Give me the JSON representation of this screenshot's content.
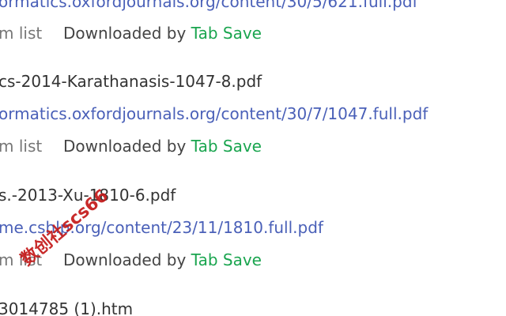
{
  "items": [
    {
      "filename": "",
      "url": "ormatics.oxfordjournals.org/content/30/5/621.full.pdf",
      "remove_label": "m list",
      "downloaded_prefix": "Downloaded by",
      "extension_name": "Tab Save"
    },
    {
      "filename": "cs-2014-Karathanasis-1047-8.pdf",
      "url": "ormatics.oxfordjournals.org/content/30/7/1047.full.pdf",
      "remove_label": "m list",
      "downloaded_prefix": "Downloaded by",
      "extension_name": "Tab Save"
    },
    {
      "filename": "s.-2013-Xu-1810-6.pdf",
      "url": "me.cshlp.org/content/23/11/1810.full.pdf",
      "remove_label": "m list",
      "downloaded_prefix": "Downloaded by",
      "extension_name": "Tab Save"
    },
    {
      "filename": "3014785 (1).htm",
      "url": "",
      "remove_label": "",
      "downloaded_prefix": "",
      "extension_name": ""
    }
  ],
  "watermark": {
    "text": "数创社scs66"
  },
  "colors": {
    "url": "#4a60b8",
    "extension": "#1aa54f",
    "watermark": "#c41818"
  }
}
